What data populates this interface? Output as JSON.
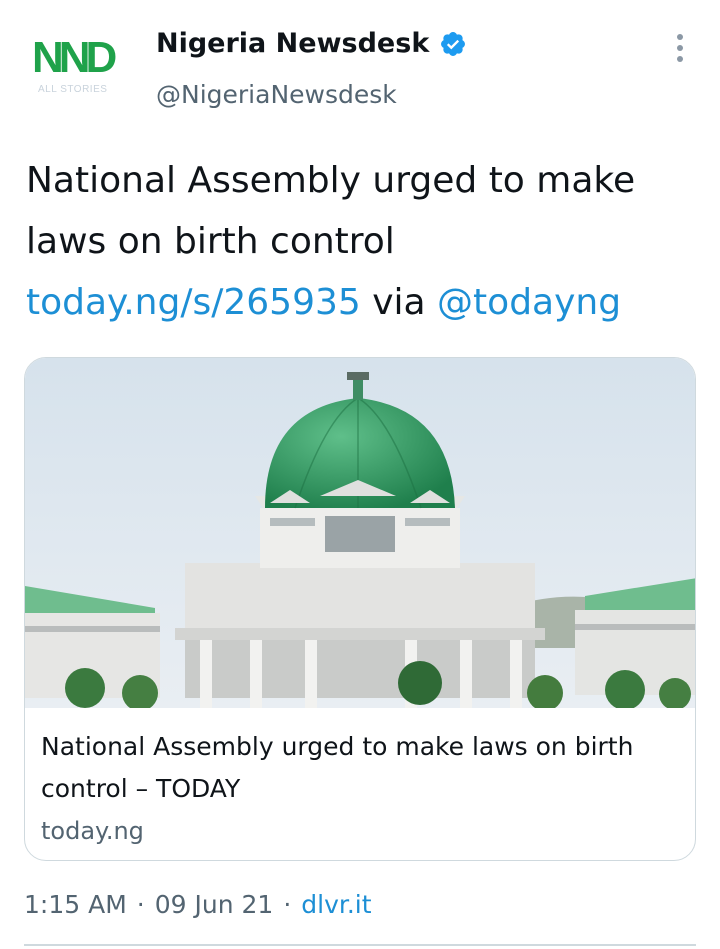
{
  "author": {
    "name": "Nigeria Newsdesk",
    "handle": "@NigeriaNewsdesk",
    "avatar_mark": "NND",
    "avatar_subtext": "ALL STORIES",
    "verified": true
  },
  "tweet": {
    "text_plain": "National Assembly urged to make laws on birth control ",
    "link": "today.ng/s/265935",
    "via_word": " via ",
    "mention": "@todayng"
  },
  "card": {
    "title": "National Assembly urged to make laws on birth control – TODAY",
    "domain": "today.ng"
  },
  "meta": {
    "time": "1:15 AM",
    "separator": "·",
    "date": "09 Jun 21",
    "source": "dlvr.it"
  },
  "colors": {
    "link_blue": "#1d8fd5",
    "verified_blue": "#1d9bf0",
    "brand_green": "#1fa24a",
    "dome_green": "#2e9a62"
  },
  "icons": {
    "more": "more-vertical-icon",
    "verified": "verified-badge-icon"
  }
}
